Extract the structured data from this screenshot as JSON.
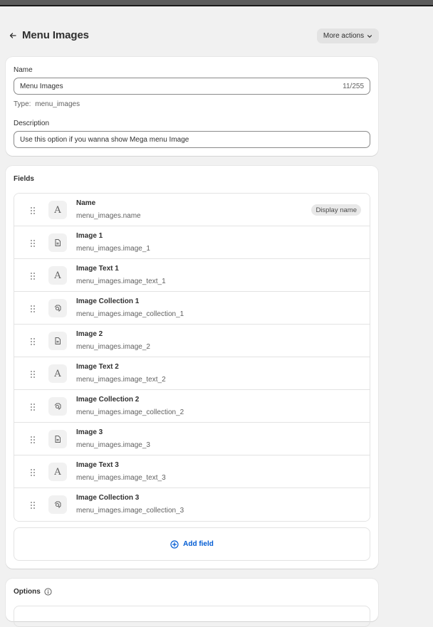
{
  "header": {
    "title": "Menu Images",
    "more_actions_label": "More actions"
  },
  "definition": {
    "name_label": "Name",
    "name_value": "Menu Images",
    "name_counter": "11/255",
    "type_label": "Type:",
    "type_value": "menu_images",
    "description_label": "Description",
    "description_value": "Use this option if you wanna show Mega menu Image"
  },
  "fields": {
    "title": "Fields",
    "items": [
      {
        "name": "Name",
        "key": "menu_images.name",
        "icon": "text-icon",
        "badge": "Display name"
      },
      {
        "name": "Image 1",
        "key": "menu_images.image_1",
        "icon": "file-icon"
      },
      {
        "name": "Image Text 1",
        "key": "menu_images.image_text_1",
        "icon": "text-icon"
      },
      {
        "name": "Image Collection 1",
        "key": "menu_images.image_collection_1",
        "icon": "collection-icon"
      },
      {
        "name": "Image 2",
        "key": "menu_images.image_2",
        "icon": "file-icon"
      },
      {
        "name": "Image Text 2",
        "key": "menu_images.image_text_2",
        "icon": "text-icon"
      },
      {
        "name": "Image Collection 2",
        "key": "menu_images.image_collection_2",
        "icon": "collection-icon"
      },
      {
        "name": "Image 3",
        "key": "menu_images.image_3",
        "icon": "file-icon"
      },
      {
        "name": "Image Text 3",
        "key": "menu_images.image_text_3",
        "icon": "text-icon"
      },
      {
        "name": "Image Collection 3",
        "key": "menu_images.image_collection_3",
        "icon": "collection-icon"
      }
    ],
    "add_field_label": "Add field"
  },
  "options": {
    "title": "Options"
  },
  "colors": {
    "accent": "#005bd3",
    "page_bg": "#f1f1f1"
  }
}
